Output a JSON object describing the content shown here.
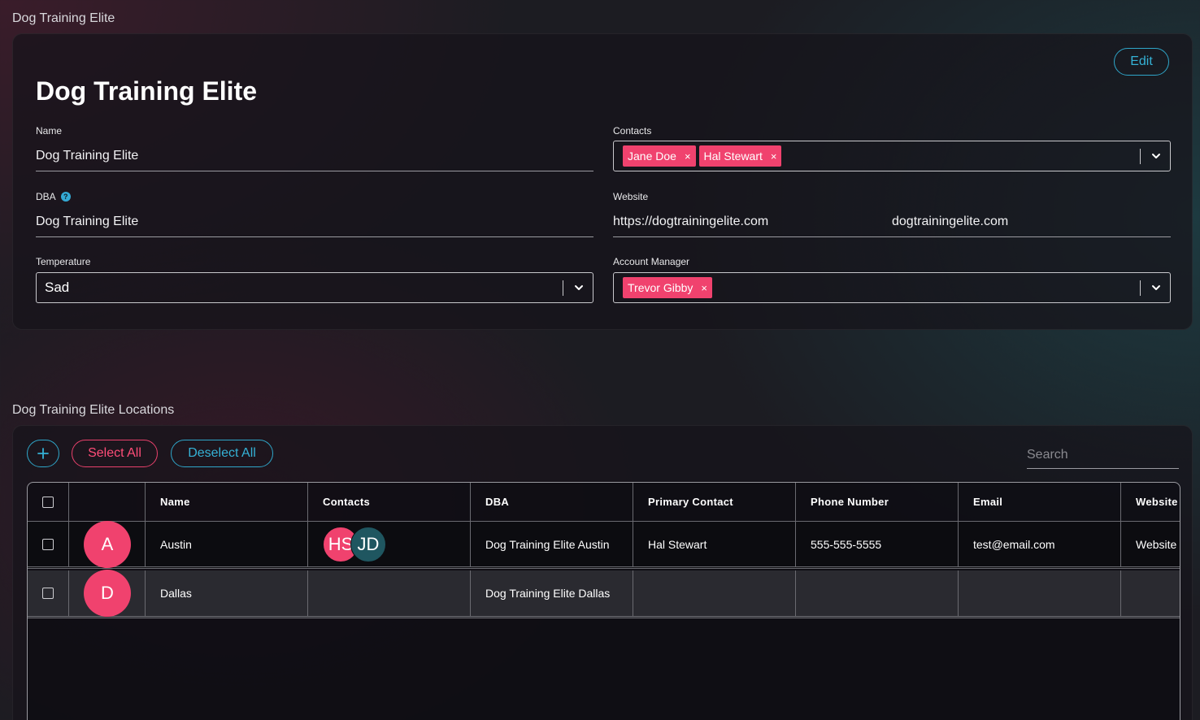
{
  "account": {
    "section_label": "Dog Training Elite",
    "title": "Dog Training Elite",
    "edit_label": "Edit",
    "fields": {
      "name_label": "Name",
      "name_value": "Dog Training Elite",
      "dba_label": "DBA",
      "dba_value": "Dog Training Elite",
      "temperature_label": "Temperature",
      "temperature_value": "Sad",
      "contacts_label": "Contacts",
      "contacts": [
        "Jane Doe",
        "Hal Stewart"
      ],
      "website_label": "Website",
      "website_url": "https://dogtrainingelite.com",
      "website_display": "dogtrainingelite.com",
      "account_manager_label": "Account Manager",
      "account_managers": [
        "Trevor Gibby"
      ]
    }
  },
  "locations": {
    "section_label": "Dog Training Elite Locations",
    "add_icon": "plus-icon",
    "select_all_label": "Select All",
    "deselect_all_label": "Deselect All",
    "search_placeholder": "Search",
    "columns": [
      "Name",
      "Contacts",
      "DBA",
      "Primary Contact",
      "Phone Number",
      "Email",
      "Website"
    ],
    "rows": [
      {
        "avatar": "A",
        "name": "Austin",
        "contacts": [
          {
            "initials": "HS",
            "color": "#f0426e"
          },
          {
            "initials": "JD",
            "color": "#1f5660"
          }
        ],
        "dba": "Dog Training Elite Austin",
        "primary_contact": "Hal Stewart",
        "phone": "555-555-5555",
        "email": "test@email.com",
        "website": "Website"
      },
      {
        "avatar": "D",
        "name": "Dallas",
        "contacts": [],
        "dba": "Dog Training Elite Dallas",
        "primary_contact": "",
        "phone": "",
        "email": "",
        "website": ""
      }
    ]
  },
  "colors": {
    "accent_blue": "#35b2d6",
    "accent_pink": "#f0426e"
  }
}
